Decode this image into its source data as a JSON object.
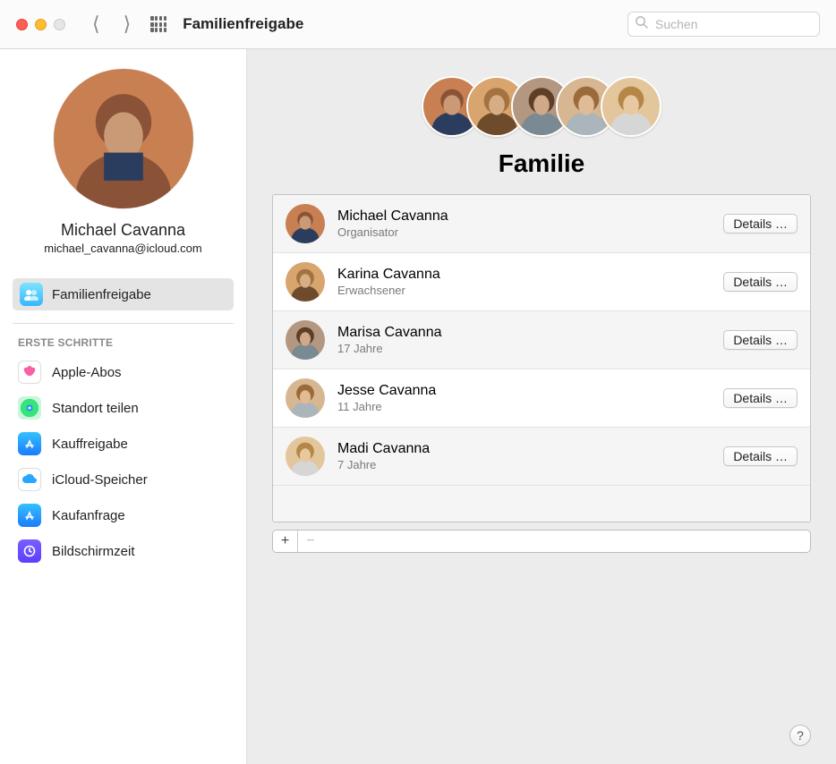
{
  "window": {
    "title": "Familienfreigabe",
    "search_placeholder": "Suchen"
  },
  "sidebar": {
    "user_name": "Michael Cavanna",
    "user_email": "michael_cavanna@icloud.com",
    "selected_label": "Familienfreigabe",
    "section_header": "ERSTE SCHRITTE",
    "links": [
      {
        "label": "Apple-Abos"
      },
      {
        "label": "Standort teilen"
      },
      {
        "label": "Kauffreigabe"
      },
      {
        "label": "iCloud-Speicher"
      },
      {
        "label": "Kaufanfrage"
      },
      {
        "label": "Bildschirmzeit"
      }
    ]
  },
  "main": {
    "title": "Familie",
    "members": [
      {
        "name": "Michael Cavanna",
        "role": "Organisator",
        "details": "Details …"
      },
      {
        "name": "Karina Cavanna",
        "role": "Erwachsener",
        "details": "Details …"
      },
      {
        "name": "Marisa Cavanna",
        "role": "17 Jahre",
        "details": "Details …"
      },
      {
        "name": "Jesse Cavanna",
        "role": "11 Jahre",
        "details": "Details …"
      },
      {
        "name": "Madi Cavanna",
        "role": "7 Jahre",
        "details": "Details …"
      }
    ],
    "add_label": "+",
    "remove_label": "−",
    "help_label": "?"
  },
  "avatars": {
    "colors": [
      "#c87f52",
      "#d8a56e",
      "#b49780",
      "#d7b791",
      "#e3c69b"
    ]
  }
}
